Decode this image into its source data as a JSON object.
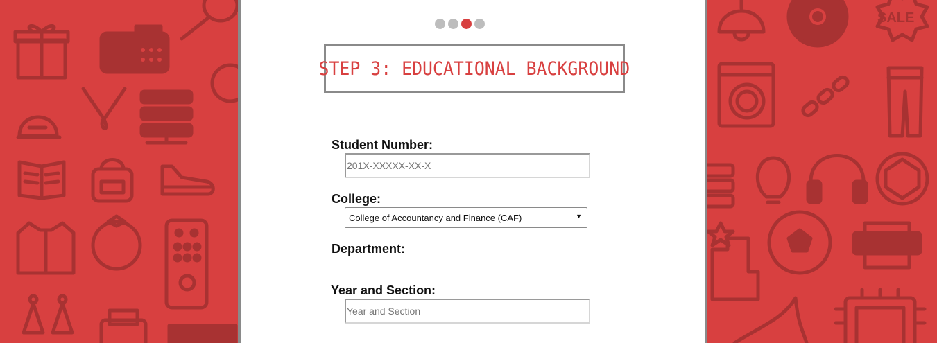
{
  "progress": {
    "steps": [
      "step-1",
      "step-2",
      "step-3",
      "step-4"
    ],
    "current_step": 3,
    "active_color": "#d84040",
    "inactive_color": "#bdbdbd"
  },
  "header": {
    "title": "STEP 3: EDUCATIONAL BACKGROUND"
  },
  "form": {
    "student_number": {
      "label": "Student Number:",
      "value": "",
      "placeholder": "201X-XXXXX-XX-X"
    },
    "college": {
      "label": "College:",
      "selected": "College of Accountancy and Finance (CAF)"
    },
    "department": {
      "label": "Department:"
    },
    "year_section": {
      "label": "Year and Section:",
      "value": "",
      "placeholder": "Year and Section"
    }
  },
  "background": {
    "color": "#d84040",
    "icon_color": "#a83232",
    "left_icons": [
      "gift-icon",
      "fax-machine-icon",
      "tennis-racket-icon",
      "cap-icon",
      "necklace-icon",
      "server-icon",
      "book-icon",
      "backpack-icon",
      "sneaker-icon",
      "shirt-icon",
      "ring-icon",
      "remote-control-icon",
      "earrings-icon",
      "printer-icon"
    ],
    "right_icons": [
      "lamp-icon",
      "disc-icon",
      "sale-badge-icon",
      "washing-machine-icon",
      "chain-icon",
      "jeans-icon",
      "server-icon",
      "lightbulb-icon",
      "headphones-icon",
      "gem-icon",
      "podium-icon",
      "soccer-ball-icon",
      "printer-icon",
      "high-heel-icon",
      "cpu-chip-icon"
    ],
    "sale_text": "SALE"
  }
}
